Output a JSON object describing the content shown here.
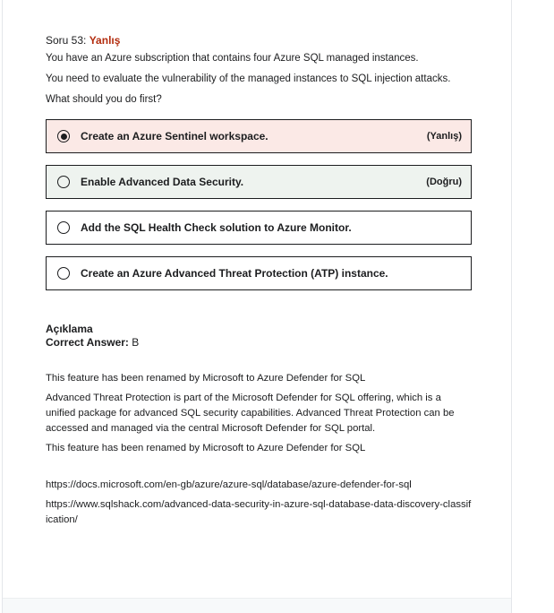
{
  "question": {
    "number_label": "Soru 53:",
    "status": "Yanlış",
    "lines": [
      "You have an Azure subscription that contains four Azure SQL managed instances.",
      "You need to evaluate the vulnerability of the managed instances to SQL injection attacks.",
      "What should you do first?"
    ]
  },
  "options": [
    {
      "label": "Create an Azure Sentinel workspace.",
      "tag": "(Yanlış)",
      "selected": true
    },
    {
      "label": "Enable Advanced Data Security.",
      "tag": "(Doğru)",
      "selected": false
    },
    {
      "label": "Add the SQL Health Check solution to Azure Monitor.",
      "tag": "",
      "selected": false
    },
    {
      "label": "Create an Azure Advanced Threat Protection (ATP) instance.",
      "tag": "",
      "selected": false
    }
  ],
  "explanation": {
    "title": "Açıklama",
    "answer_label": "Correct Answer:",
    "answer_value": " B",
    "paragraphs": [
      "This feature has been renamed by Microsoft to Azure Defender for SQL",
      "Advanced Threat Protection is part of the Microsoft Defender for SQL offering, which is a unified package for advanced SQL security capabilities. Advanced Threat Protection can be accessed and managed via the central Microsoft Defender for SQL portal.",
      "This feature has been renamed by Microsoft to Azure Defender for SQL"
    ],
    "references": [
      "https://docs.microsoft.com/en-gb/azure/azure-sql/database/azure-defender-for-sql",
      "https://www.sqlshack.com/advanced-data-security-in-azure-sql-database-data-discovery-classification/"
    ]
  }
}
